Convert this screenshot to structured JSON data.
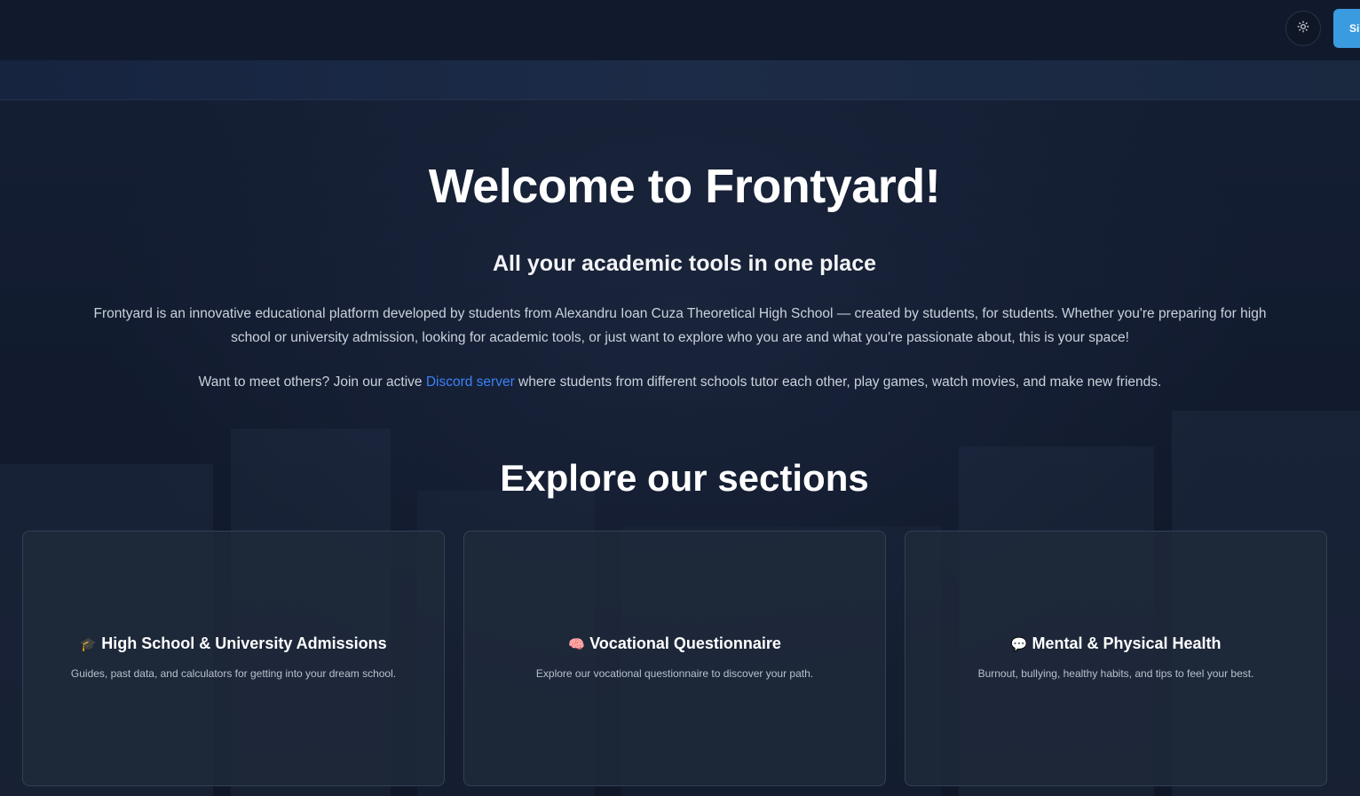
{
  "header": {
    "theme_toggle_icon": "sun-icon",
    "signin_label": "Si"
  },
  "hero": {
    "title": "Welcome to Frontyard!",
    "subtitle": "All your academic tools in one place",
    "description": "Frontyard is an innovative educational platform developed by students from Alexandru Ioan Cuza Theoretical High School — created by students, for students. Whether you're preparing for high school or university admission, looking for academic tools, or just want to explore who you are and what you're passionate about, this is your space!",
    "discord_prefix": "Want to meet others? Join our active ",
    "discord_link": "Discord server",
    "discord_suffix": " where students from different schools tutor each other, play games, watch movies, and make new friends."
  },
  "sections": {
    "heading": "Explore our sections",
    "cards": [
      {
        "icon": "graduation-cap-icon",
        "glyph": "🎓",
        "title": "High School & University Admissions",
        "description": "Guides, past data, and calculators for getting into your dream school."
      },
      {
        "icon": "brain-icon",
        "glyph": "🧠",
        "title": "Vocational Questionnaire",
        "description": "Explore our vocational questionnaire to discover your path."
      },
      {
        "icon": "speech-bubble-icon",
        "glyph": "💬",
        "title": "Mental & Physical Health",
        "description": "Burnout, bullying, healthy habits, and tips to feel your best."
      }
    ]
  },
  "colors": {
    "background": "#101828",
    "accent": "#3b9be0",
    "link": "#3b82f6"
  }
}
